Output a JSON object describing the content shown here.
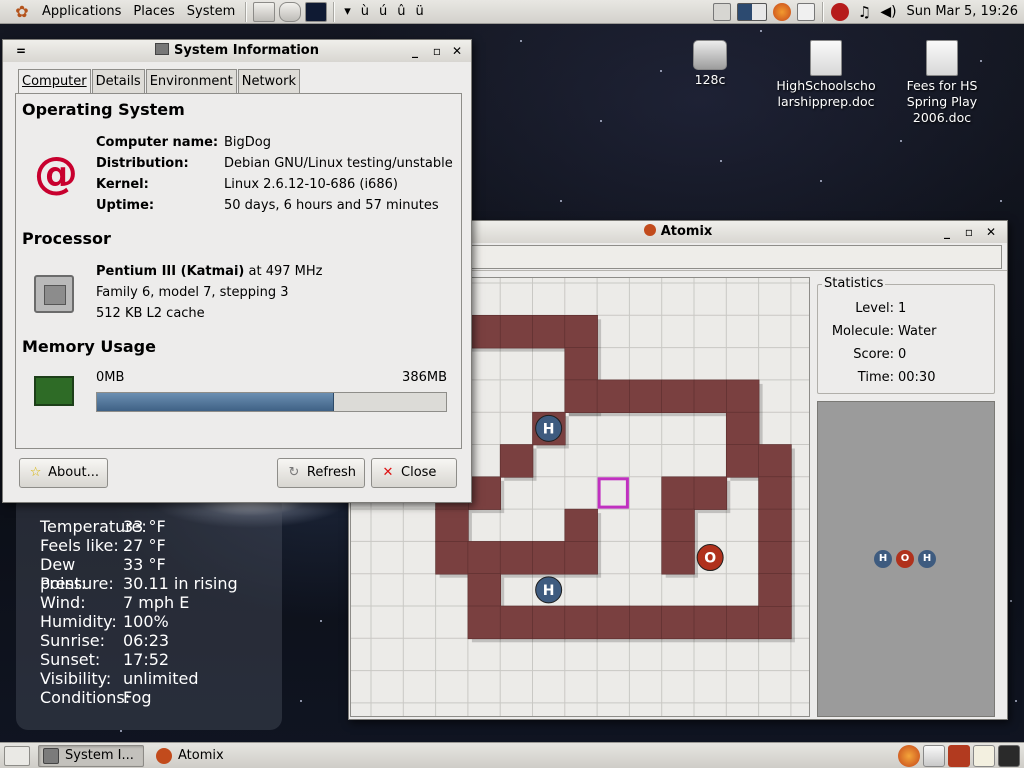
{
  "top_panel": {
    "menus": [
      "Applications",
      "Places",
      "System"
    ],
    "char_items": [
      "ù",
      "ú",
      "û",
      "ü"
    ],
    "clock": "Sun Mar  5, 19:26"
  },
  "desktop_icons": [
    {
      "label": "128c"
    },
    {
      "label": "HighSchoolscholarshipprep.doc"
    },
    {
      "label": "Fees for HS Spring Play 2006.doc"
    }
  ],
  "weather": {
    "rows": [
      {
        "k": "Temperature:",
        "v": "33 °F"
      },
      {
        "k": "Feels like:",
        "v": "27 °F"
      },
      {
        "k": "Dew point:",
        "v": "33 °F"
      },
      {
        "k": "Pressure:",
        "v": "30.11 in rising"
      },
      {
        "k": "Wind:",
        "v": "7 mph E"
      },
      {
        "k": "Humidity:",
        "v": "100%"
      },
      {
        "k": "Sunrise:",
        "v": "06:23"
      },
      {
        "k": "Sunset:",
        "v": "17:52"
      },
      {
        "k": "Visibility:",
        "v": "unlimited"
      },
      {
        "k": "Conditions:",
        "v": "Fog"
      }
    ]
  },
  "sysinfo": {
    "title": "System Information",
    "tabs": [
      "Computer",
      "Details",
      "Environment",
      "Network"
    ],
    "os": {
      "heading": "Operating System",
      "rows": [
        {
          "k": "Computer name:",
          "v": "BigDog"
        },
        {
          "k": "Distribution:",
          "v": "Debian GNU/Linux testing/unstable"
        },
        {
          "k": "Kernel:",
          "v": "Linux 2.6.12-10-686 (i686)"
        },
        {
          "k": "Uptime:",
          "v": "50 days, 6 hours and 57 minutes"
        }
      ]
    },
    "processor": {
      "heading": "Processor",
      "name": "Pentium III (Katmai)",
      "speed": " at 497 MHz",
      "line2": "Family 6, model 7, stepping 3",
      "line3": "512 KB L2 cache"
    },
    "memory": {
      "heading": "Memory Usage",
      "min_label": "0MB",
      "max_label": "386MB",
      "used_fraction": 0.68
    },
    "buttons": {
      "about": "About...",
      "refresh": "Refresh",
      "close": "Close"
    }
  },
  "atomix": {
    "title": "Atomix",
    "stats": {
      "legend": "Statistics",
      "rows": [
        {
          "k": "Level:",
          "v": "1"
        },
        {
          "k": "Molecule:",
          "v": "Water"
        },
        {
          "k": "Score:",
          "v": "0"
        },
        {
          "k": "Time:",
          "v": "00:30"
        }
      ]
    },
    "atoms": [
      {
        "symbol": "H",
        "col": 5,
        "row": 4,
        "color": "#3e5b7f"
      },
      {
        "symbol": "H",
        "col": 5,
        "row": 9,
        "color": "#3e5b7f"
      },
      {
        "symbol": "O",
        "col": 10,
        "row": 8,
        "color": "#b0311c"
      }
    ],
    "molecule": [
      {
        "symbol": "H",
        "color": "#3e5b7f"
      },
      {
        "symbol": "O",
        "color": "#b0311c"
      },
      {
        "symbol": "H",
        "color": "#3e5b7f"
      }
    ],
    "wall_color": "#7a4040"
  },
  "taskbar": {
    "tasks": [
      {
        "label": "System I..."
      },
      {
        "label": "Atomix"
      }
    ]
  }
}
